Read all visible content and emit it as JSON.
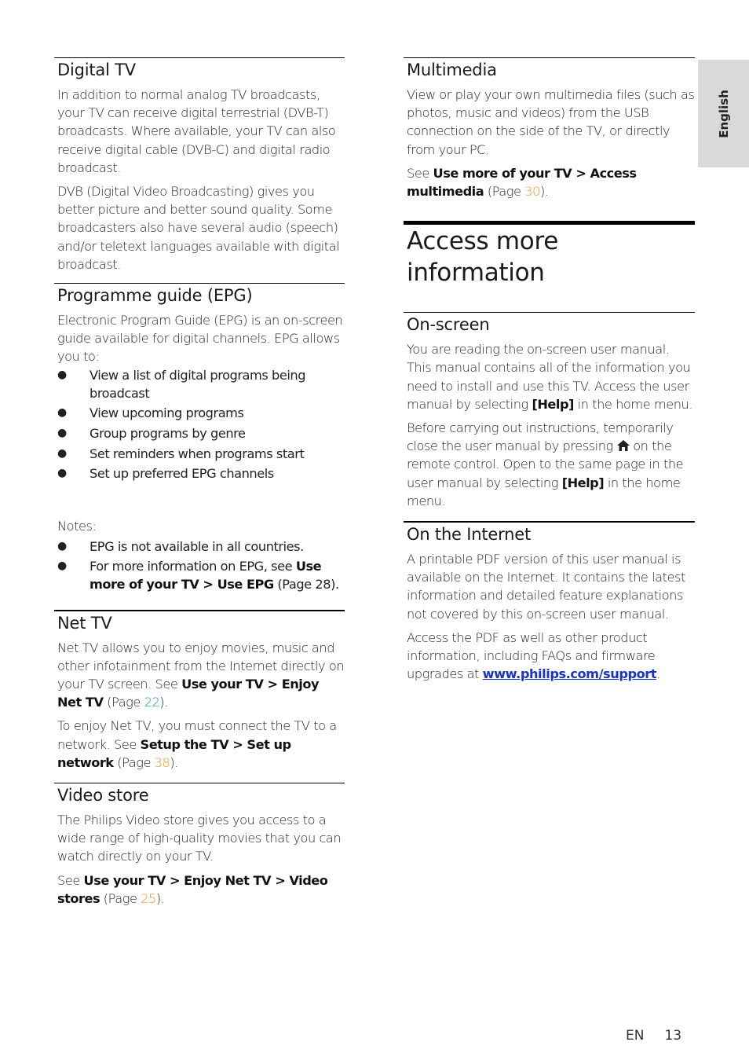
{
  "language_tab": "English",
  "footer": {
    "lang": "EN",
    "page_number": "13"
  },
  "left": {
    "digital_tv": {
      "title": "Digital TV",
      "p1": "In addition to normal analog TV broadcasts, your TV can receive digital terrestrial (DVB-T) broadcasts. Where available, your TV can also receive digital cable (DVB-C) and digital radio broadcast.",
      "p2": "DVB (Digital Video Broadcasting) gives you better picture and better sound quality. Some broadcasters also have several audio (speech) and/or teletext languages available with digital broadcast."
    },
    "epg": {
      "title": "Programme guide (EPG)",
      "intro": "Electronic Program Guide (EPG) is an on-screen guide available for digital channels. EPG allows you to:",
      "bullets": [
        "View a list of digital programs being broadcast",
        "View upcoming programs",
        "Group programs by genre",
        "Set reminders when programs start",
        "Set up preferred EPG channels"
      ],
      "notes_label": "Notes:",
      "note1": "EPG is not available in all countries.",
      "note2_prefix": "For more information on EPG, see ",
      "note2_bold": "Use more of your TV > Use EPG",
      "note2_page_prefix": " (Page ",
      "note2_page": "28",
      "note2_suffix": ")."
    },
    "net_tv": {
      "title": "Net TV",
      "p1_text": "Net TV allows you to enjoy movies, music and other infotainment from the Internet directly on your TV screen. See ",
      "p1_bold": "Use your TV > Enjoy Net TV",
      "p1_page_prefix": " (Page ",
      "p1_page": "22",
      "p1_suffix": ").",
      "p2_text": "To enjoy Net TV, you must connect the TV to a network. See ",
      "p2_bold": "Setup the TV > Set up network",
      "p2_page_prefix": " (Page ",
      "p2_page": "38",
      "p2_suffix": ")."
    },
    "video_store": {
      "title": "Video store",
      "p1": "The Philips Video store gives you access to a wide range of high-quality movies that you can watch directly on your TV.",
      "p2_text": "See ",
      "p2_bold": "Use your TV > Enjoy Net TV > Video stores",
      "p2_page_prefix": " (Page ",
      "p2_page": "25",
      "p2_suffix": ")."
    }
  },
  "right": {
    "multimedia": {
      "title": "Multimedia",
      "p1": "View or play your own multimedia files (such as photos, music and videos) from the USB connection on the side of the TV, or directly from your PC.",
      "p2_text": "See ",
      "p2_bold": "Use more of your TV > Access multimedia",
      "p2_page_prefix": " (Page ",
      "p2_page": "30",
      "p2_suffix": ")."
    },
    "access_more": {
      "title": "Access more information"
    },
    "on_screen": {
      "title": "On-screen",
      "p1_text": "You are reading the on-screen user manual. This manual contains all of the information you need to install and use this TV. Access the user manual by selecting ",
      "p1_bold": "[Help]",
      "p1_suffix": " in the home menu.",
      "p2_text": "Before carrying out instructions, temporarily close the user manual by pressing ",
      "p2_icon": "home-icon",
      "p2_mid": " on the remote control. Open to the same page in the user manual by selecting ",
      "p2_bold": "[Help]",
      "p2_suffix": " in the home menu."
    },
    "internet": {
      "title": "On the Internet",
      "p1": "A printable PDF version of this user manual is available on the Internet. It contains the latest information and detailed feature explanations not covered by this on-screen user manual.",
      "p2_text": "Access the PDF as well as other product information, including FAQs and firmware upgrades at ",
      "p2_link": "www.philips.com/support",
      "p2_suffix": "."
    }
  },
  "colors": {
    "page_ref_blue": "#1f8ac7",
    "page_ref_orange": "#f2922a",
    "link": "#1a33c8",
    "tab_bg": "#d9d9d9"
  }
}
